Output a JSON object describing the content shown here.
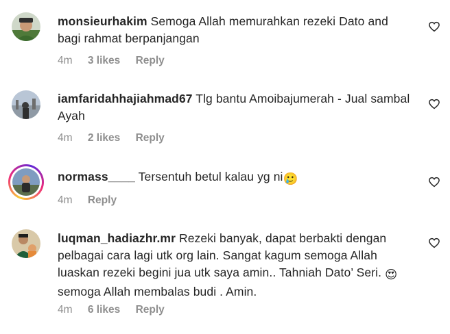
{
  "comments": [
    {
      "username": "monsieurhakim",
      "text": "Semoga Allah memurahkan rezeki Dato and bagi rahmat berpanjangan",
      "time": "4m",
      "likes": "3 likes",
      "reply": "Reply",
      "avatar_icon": "user-avatar-photo"
    },
    {
      "username": "iamfaridahhajiahmad67",
      "text": "Tlg bantu Amoibajumerah - Jual sambal Ayah",
      "time": "4m",
      "likes": "2 likes",
      "reply": "Reply",
      "avatar_icon": "user-avatar-photo"
    },
    {
      "username": "normass____",
      "text": "Tersentuh betul kalau yg ni",
      "emoji": "🥲",
      "time": "4m",
      "reply": "Reply",
      "avatar_icon": "story-ring-avatar"
    },
    {
      "username": "luqman_hadiazhr.mr",
      "text": "Rezeki banyak, dapat berbakti dengan pelbagai cara lagi utk org lain. Sangat kagum semoga Allah luaskan rezeki begini jua utk saya amin.. Tahniah Dato’ Seri.",
      "emoji": "😍",
      "text2": "semoga Allah membalas budi . Amin.",
      "time": "4m",
      "likes": "6 likes",
      "reply": "Reply",
      "avatar_icon": "user-avatar-photo"
    }
  ],
  "colors": {
    "primary_text": "#262626",
    "secondary_text": "#8e8e8e",
    "background": "#ffffff"
  },
  "icons": {
    "like": "heart-outline-icon"
  }
}
